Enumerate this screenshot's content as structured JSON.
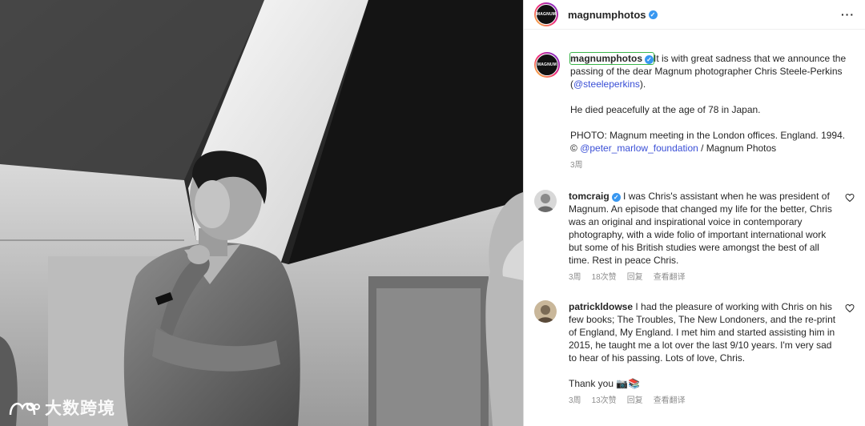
{
  "post": {
    "username": "magnumphotos",
    "avatar_text": "MAGNUM",
    "more_icon": "···",
    "caption": {
      "lead": "It is with great sadness that we announce the passing of the dear Magnum photographer Chris Steele-Perkins (",
      "mention1": "@steeleperkins",
      "lead_end": ").",
      "para2": "He died peacefully at the age of 78 in Japan.",
      "para3": "PHOTO: Magnum meeting in the London offices. England. 1994.",
      "credit_prefix": "© ",
      "mention2": "@peter_marlow_foundation",
      "credit_suffix": " / Magnum Photos",
      "time": "3周"
    }
  },
  "comments": [
    {
      "username": "tomcraig",
      "verified": true,
      "text": "I was Chris's assistant when he was president of Magnum. An episode that changed my life for the better, Chris was an original and inspirational voice in contemporary photography, with a wide folio of important international work but some of his British studies were amongst the best of all time. Rest in peace Chris.",
      "time": "3周",
      "likes": "18次赞",
      "reply": "回复",
      "translate": "查看翻译"
    },
    {
      "username": "patrickldowse",
      "verified": false,
      "text": "I had the pleasure of working with Chris on his few books; The Troubles, The New Londoners, and the re-print of England, My England. I met him and started assisting him in 2015, he taught me a lot over the last 9/10 years. I'm very sad to hear of his passing. Lots of love, Chris.",
      "text2": "Thank you 📷📚",
      "time": "3周",
      "likes": "13次赞",
      "reply": "回复",
      "translate": "查看翻译"
    }
  ],
  "watermark": {
    "text": "大数跨境"
  },
  "colors": {
    "verified": "#3897f0",
    "mention": "#3a4fd6",
    "meta": "#8e8e8e"
  }
}
